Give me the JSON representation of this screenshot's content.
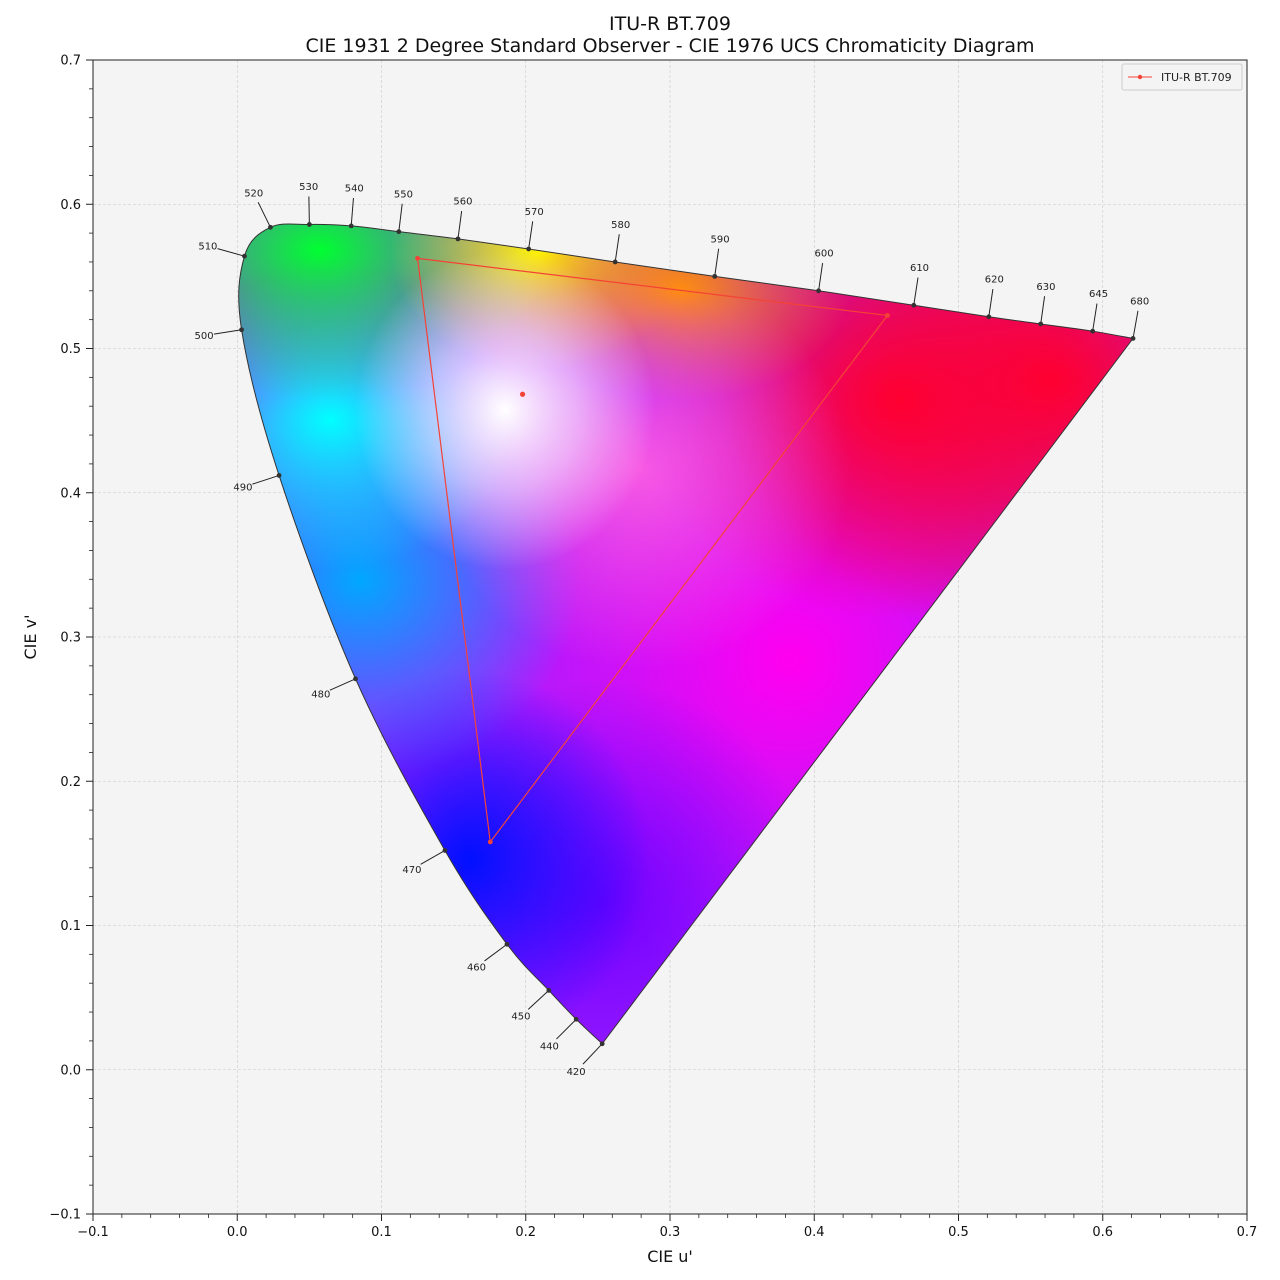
{
  "chart_data": {
    "type": "scatter",
    "title": "ITU-R BT.709",
    "subtitle": "CIE 1931 2 Degree Standard Observer - CIE 1976 UCS Chromaticity Diagram",
    "xlabel": "CIE u'",
    "ylabel": "CIE v'",
    "xlim": [
      -0.1,
      0.7
    ],
    "ylim": [
      -0.1,
      0.7
    ],
    "xticks": [
      "−0.1",
      "0.0",
      "0.1",
      "0.2",
      "0.3",
      "0.4",
      "0.5",
      "0.6",
      "0.7"
    ],
    "yticks": [
      "−0.1",
      "0.0",
      "0.1",
      "0.2",
      "0.3",
      "0.4",
      "0.5",
      "0.6",
      "0.7"
    ],
    "grid": true,
    "legend_position": "top-right",
    "background_color": "#f4f4f4",
    "spectral_locus": [
      {
        "wl": "420",
        "u": 0.253,
        "v": 0.018
      },
      {
        "wl": "440",
        "u": 0.235,
        "v": 0.035
      },
      {
        "wl": "450",
        "u": 0.216,
        "v": 0.055
      },
      {
        "wl": "460",
        "u": 0.187,
        "v": 0.087
      },
      {
        "wl": "470",
        "u": 0.144,
        "v": 0.152
      },
      {
        "wl": "480",
        "u": 0.082,
        "v": 0.271
      },
      {
        "wl": "490",
        "u": 0.029,
        "v": 0.412
      },
      {
        "wl": "500",
        "u": 0.003,
        "v": 0.513
      },
      {
        "wl": "510",
        "u": 0.005,
        "v": 0.564
      },
      {
        "wl": "520",
        "u": 0.023,
        "v": 0.584
      },
      {
        "wl": "530",
        "u": 0.05,
        "v": 0.586
      },
      {
        "wl": "540",
        "u": 0.079,
        "v": 0.585
      },
      {
        "wl": "550",
        "u": 0.112,
        "v": 0.581
      },
      {
        "wl": "560",
        "u": 0.153,
        "v": 0.576
      },
      {
        "wl": "570",
        "u": 0.202,
        "v": 0.569
      },
      {
        "wl": "580",
        "u": 0.262,
        "v": 0.56
      },
      {
        "wl": "590",
        "u": 0.331,
        "v": 0.55
      },
      {
        "wl": "600",
        "u": 0.403,
        "v": 0.54
      },
      {
        "wl": "610",
        "u": 0.469,
        "v": 0.53
      },
      {
        "wl": "620",
        "u": 0.521,
        "v": 0.522
      },
      {
        "wl": "630",
        "u": 0.557,
        "v": 0.517
      },
      {
        "wl": "645",
        "u": 0.593,
        "v": 0.512
      },
      {
        "wl": "680",
        "u": 0.621,
        "v": 0.507
      }
    ],
    "series": [
      {
        "name": "ITU-R BT.709",
        "color": "#f44336",
        "points": [
          {
            "u": 0.4507,
            "v": 0.5229
          },
          {
            "u": 0.125,
            "v": 0.5625
          },
          {
            "u": 0.1754,
            "v": 0.1579
          },
          {
            "u": 0.4507,
            "v": 0.5229
          }
        ]
      }
    ],
    "whitepoint": {
      "u": 0.1978,
      "v": 0.4683
    }
  }
}
